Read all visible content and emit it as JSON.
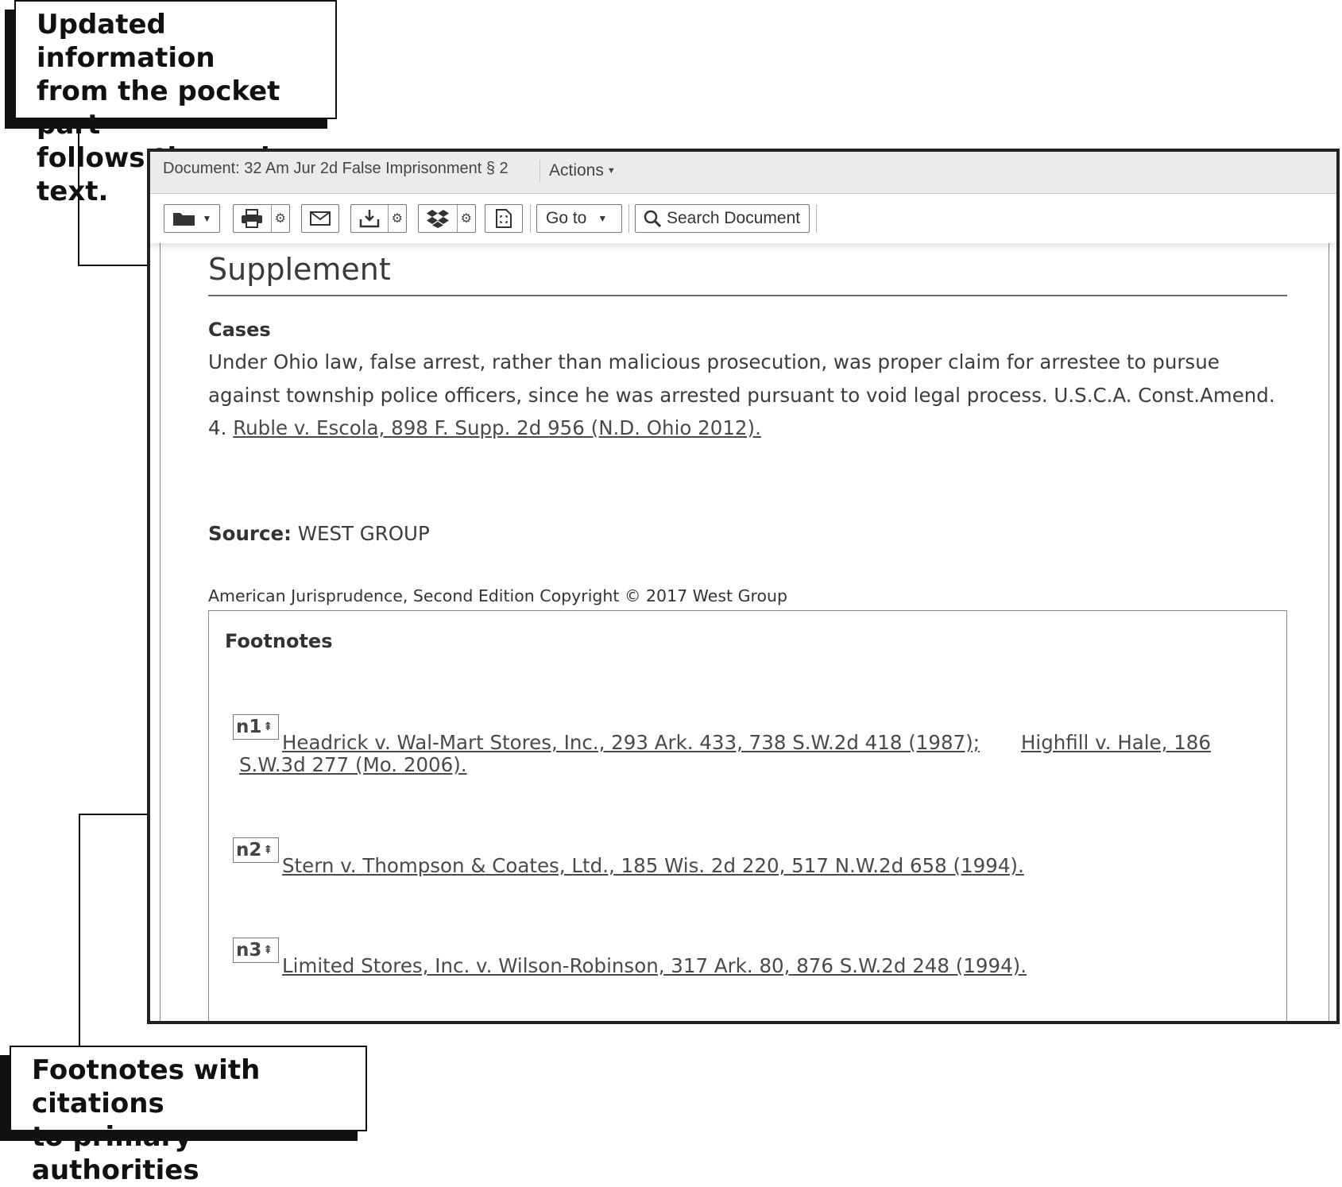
{
  "callouts": {
    "top": "Updated information\nfrom the pocket part\nfollows the main text.",
    "bottom": "Footnotes with citations\nto primary authorities"
  },
  "header": {
    "document_title": "Document: 32 Am Jur 2d False Imprisonment § 2",
    "actions_label": "Actions"
  },
  "toolbar": {
    "folder_icon": "folder-icon",
    "print_icon": "printer-icon",
    "email_icon": "envelope-icon",
    "download_icon": "download-icon",
    "dropbox_icon": "dropbox-icon",
    "page_icon": "document-icon",
    "goto_label": "Go to",
    "search_label": "Search Document"
  },
  "content": {
    "section_heading": "Supplement",
    "cases_label": "Cases",
    "cases_text": "Under Ohio law, false arrest, rather than malicious prosecution, was proper claim for arrestee to pursue against township police officers, since he was arrested pursuant to void legal process. U.S.C.A. Const.Amend. 4.",
    "cases_citation": "Ruble v. Escola, 898 F. Supp. 2d 956 (N.D. Ohio 2012).",
    "source_label": "Source:",
    "source_value": "WEST GROUP",
    "copyright": "American Jurisprudence, Second Edition Copyright © 2017 West Group"
  },
  "footnotes": {
    "title": "Footnotes",
    "items": [
      {
        "tag": "n1",
        "citations": [
          "Headrick v. Wal-Mart Stores, Inc., 293 Ark. 433, 738 S.W.2d 418 (1987);",
          "Highfill v. Hale, 186",
          "S.W.3d 277 (Mo. 2006)."
        ]
      },
      {
        "tag": "n2",
        "citations": [
          "Stern v. Thompson & Coates, Ltd., 185 Wis. 2d 220, 517 N.W.2d 658 (1994)."
        ]
      },
      {
        "tag": "n3",
        "citations": [
          "Limited Stores, Inc. v. Wilson-Robinson, 317 Ark. 80, 876 S.W.2d 248 (1994)."
        ]
      }
    ]
  }
}
